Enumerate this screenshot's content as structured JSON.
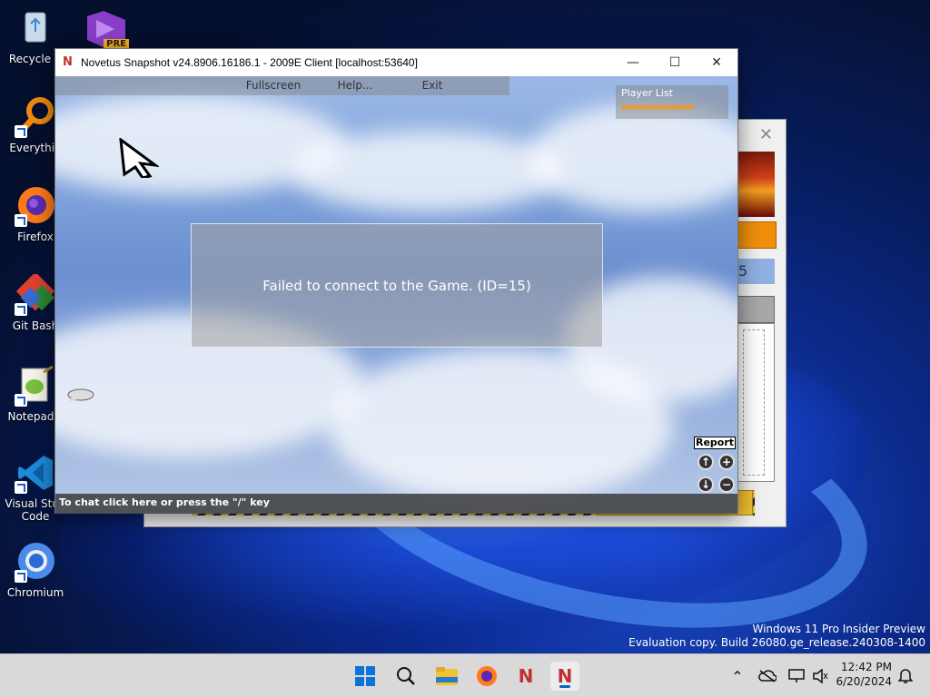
{
  "desktop": {
    "icons": [
      {
        "label": "Recycle B",
        "icon": "recycle-bin-icon"
      },
      {
        "label": "Everythin",
        "icon": "everything-search-icon"
      },
      {
        "label": "Firefox",
        "icon": "firefox-icon"
      },
      {
        "label": "Git Bash",
        "icon": "git-bash-icon"
      },
      {
        "label": "Notepad+",
        "icon": "notepad-plus-icon"
      },
      {
        "label": "Visual Stud Code",
        "icon": "vscode-icon"
      },
      {
        "label": "Chromium",
        "icon": "chromium-icon"
      }
    ],
    "top_icon_badge": "PRE"
  },
  "game_window": {
    "title": "Novetus Snapshot v24.8906.16186.1 - 2009E Client [localhost:53640]",
    "menu": [
      "Fullscreen",
      "Help...",
      "Exit"
    ],
    "player_list_title": "Player List",
    "dialog_message": "Failed to connect to the Game. (ID=15)",
    "report_label": "Report",
    "chat_hint": "To chat click here or press the \"/\" key"
  },
  "launcher_window": {
    "partial_text": "5"
  },
  "watermark": {
    "line1": "Windows 11 Pro Insider Preview",
    "line2": "Evaluation copy. Build 26080.ge_release.240308-1400"
  },
  "taskbar": {
    "time": "12:42 PM",
    "date": "6/20/2024"
  },
  "colors": {
    "accent": "#0067c0",
    "player_name": "#e69a2a",
    "launcher_orange": "#f0900a"
  }
}
